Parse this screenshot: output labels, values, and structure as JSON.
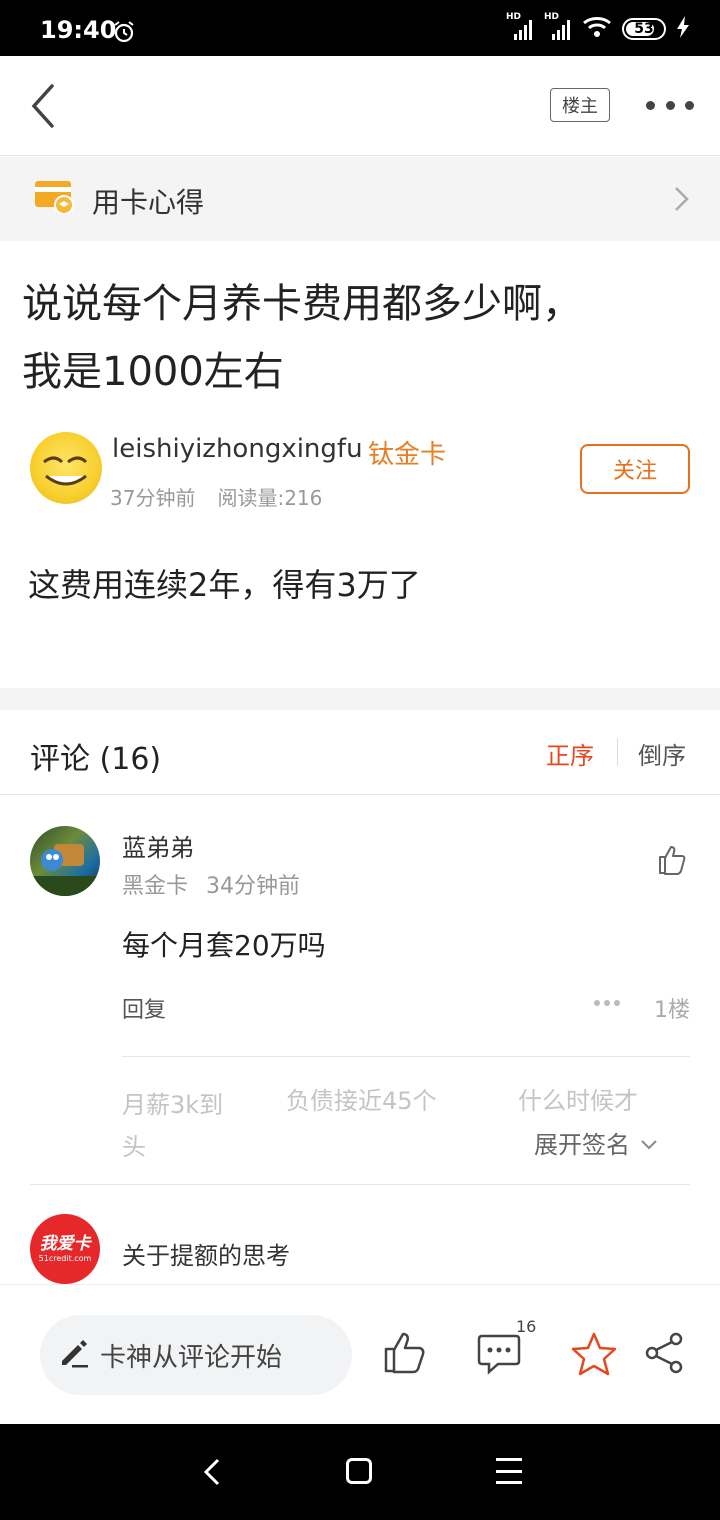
{
  "status_bar": {
    "time": "19:40",
    "battery": "53",
    "network_1": "HD",
    "network_2": "HD"
  },
  "topbar": {
    "louzhu_label": "楼主"
  },
  "category": {
    "label": "用卡心得"
  },
  "post": {
    "title_line1": "说说每个月养卡费用都多少啊，",
    "title_line2": "我是1000左右",
    "author": "leishiyizhongxingfu",
    "author_badge": "钛金卡",
    "time_ago": "37分钟前",
    "reads": "阅读量:216",
    "follow_label": "关注",
    "body": "这费用连续2年，得有3万了"
  },
  "comments_section": {
    "title": "评论 (16)",
    "sort_asc": "正序",
    "sort_desc": "倒序",
    "comments": [
      {
        "name": "蓝弟弟",
        "badge": "黑金卡",
        "time": "34分钟前",
        "text": "每个月套20万吗",
        "reply_label": "回复",
        "floor": "1楼",
        "signature": {
          "part1": "月薪3k到头",
          "part2": "负债接近45个",
          "part3": "什么时候才",
          "expand_label": "展开签名"
        }
      }
    ]
  },
  "ad": {
    "logo_main": "我爱卡",
    "logo_sub": "51credit.com",
    "title": "关于提额的思考"
  },
  "bottom_bar": {
    "comment_placeholder": "卡神从评论开始",
    "comment_count": "16"
  },
  "colors": {
    "accent_orange": "#e8701a",
    "accent_red": "#e8471c",
    "badge_orange": "#e67e22",
    "ad_red": "#e6282b"
  }
}
